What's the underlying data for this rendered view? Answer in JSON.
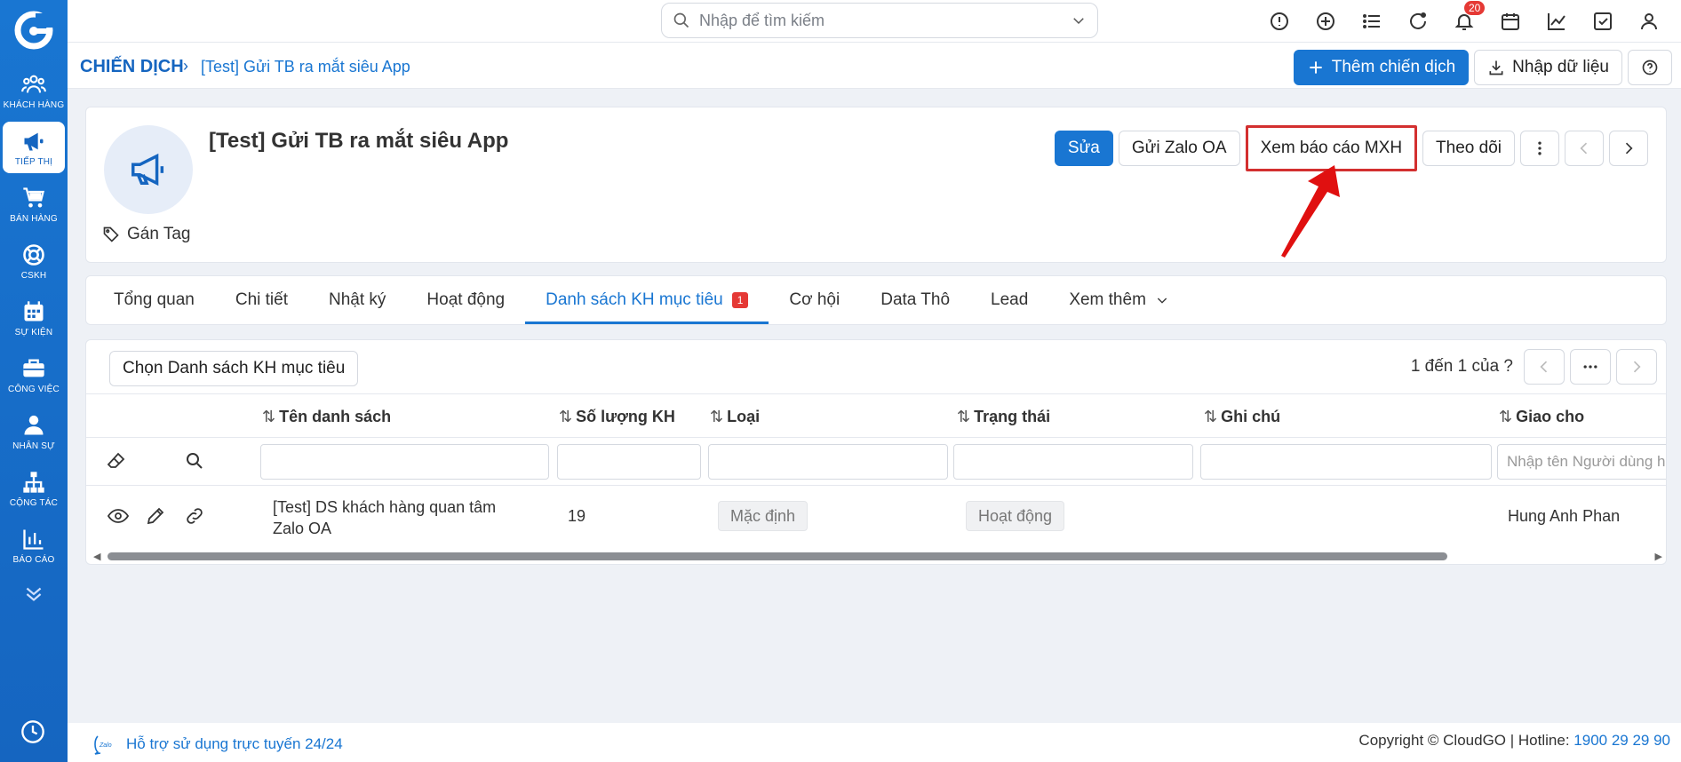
{
  "topbar": {
    "search_placeholder": "Nhập để tìm kiếm",
    "notification_count": "20"
  },
  "sidebar": {
    "items": [
      {
        "label": "KHÁCH HÀNG",
        "icon": "users-icon"
      },
      {
        "label": "TIẾP THỊ",
        "icon": "megaphone-icon",
        "active": true
      },
      {
        "label": "BÁN HÀNG",
        "icon": "cart-icon"
      },
      {
        "label": "CSKH",
        "icon": "lifebuoy-icon"
      },
      {
        "label": "SỰ KIỆN",
        "icon": "calendar-icon"
      },
      {
        "label": "CÔNG VIỆC",
        "icon": "briefcase-icon"
      },
      {
        "label": "NHÂN SỰ",
        "icon": "person-icon"
      },
      {
        "label": "CỘNG TÁC",
        "icon": "org-chart-icon"
      },
      {
        "label": "BÁO CÁO",
        "icon": "bar-chart-icon"
      }
    ]
  },
  "breadcrumb": {
    "root": "CHIẾN DỊCH",
    "separator": "›",
    "current": "[Test] Gửi TB ra mắt siêu App"
  },
  "toolbar": {
    "add_campaign_label": "Thêm chiến dịch",
    "import_label": "Nhập dữ liệu"
  },
  "campaign": {
    "title": "[Test] Gửi TB ra mắt siêu App",
    "tag_label": "Gán Tag",
    "actions": {
      "edit": "Sửa",
      "send_zalo": "Gửi Zalo OA",
      "view_report": "Xem báo cáo MXH",
      "follow": "Theo dõi"
    }
  },
  "tabs": {
    "items": [
      "Tổng quan",
      "Chi tiết",
      "Nhật ký",
      "Hoạt động",
      "Danh sách KH mục tiêu",
      "Cơ hội",
      "Data Thô",
      "Lead",
      "Xem thêm"
    ],
    "active_badge": "1"
  },
  "target_list": {
    "choose_label": "Chọn Danh sách KH mục tiêu",
    "pager_text": "1 đến 1 của",
    "pager_question": "?",
    "columns": [
      "Tên danh sách",
      "Số lượng KH",
      "Loại",
      "Trạng thái",
      "Ghi chú",
      "Giao cho"
    ],
    "assignee_filter_placeholder": "Nhập tên Người dùng hoặc Nhóm",
    "rows": [
      {
        "name_line1": "[Test] DS khách hàng quan tâm",
        "name_line2": "Zalo OA",
        "count": "19",
        "type": "Mặc định",
        "status": "Hoạt động",
        "note": "",
        "assignee": "Hung Anh Phan"
      }
    ]
  },
  "footer": {
    "support": "Hỗ trợ sử dụng trực tuyến 24/24",
    "copyright": "Copyright © CloudGO",
    "hotline_label": "Hotline:",
    "hotline_number": "1900 29 29 90"
  },
  "colors": {
    "brand": "#1976d2",
    "highlight_box": "#d32f2f",
    "badge": "#e53935"
  }
}
